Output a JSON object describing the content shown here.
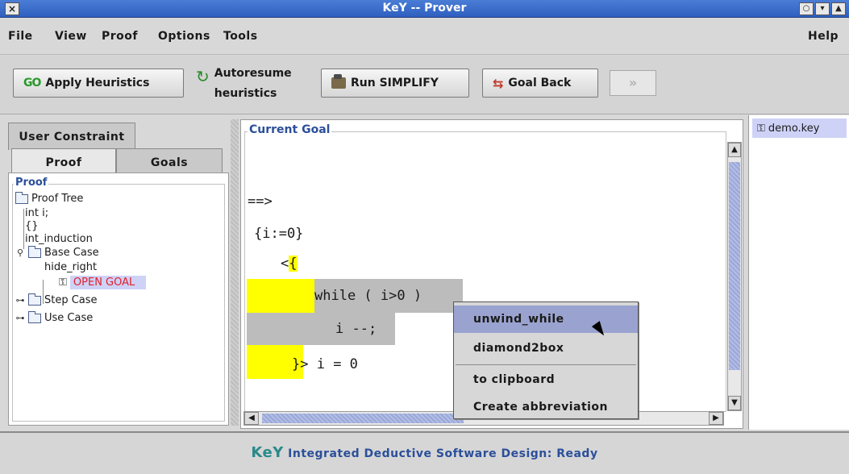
{
  "window": {
    "title": "KeY -- Prover",
    "close_glyph": "×"
  },
  "menu": {
    "file": "File",
    "view": "View",
    "proof": "Proof",
    "options": "Options",
    "tools": "Tools",
    "help": "Help"
  },
  "toolbar": {
    "apply_heuristics": {
      "icon": "GO",
      "label": "Apply Heuristics"
    },
    "autoresume": {
      "line1": "Autoresume",
      "line2": "heuristics"
    },
    "run_simplify": "Run SIMPLIFY",
    "goal_back": "Goal Back",
    "next": "»"
  },
  "left": {
    "tabs": {
      "user_constraint": "User Constraint",
      "proof": "Proof",
      "goals": "Goals"
    },
    "panel_title": "Proof",
    "tree": {
      "root": "Proof Tree",
      "n1": "int i;",
      "n2": "{}",
      "n3": "int_induction",
      "base_case": "Base Case",
      "hide_right": "hide_right",
      "open_goal": "OPEN GOAL",
      "step_case": "Step Case",
      "use_case": "Use Case"
    }
  },
  "goal": {
    "title": "Current Goal",
    "lines": {
      "l1": "==>",
      "l2": "{i:=0}",
      "l3a": "<",
      "l3b": "{",
      "l4": "while ( i>0 )",
      "l5": "i --;",
      "l6a": "}",
      "l6b": "> i = 0"
    }
  },
  "context_menu": {
    "unwind_while": "unwind_while",
    "diamond2box": "diamond2box",
    "to_clipboard": "to clipboard",
    "create_abbreviation": "Create abbreviation"
  },
  "right": {
    "file": "demo.key"
  },
  "status": {
    "logo": "KeY",
    "text": "Integrated Deductive Software Design: Ready"
  },
  "colors": {
    "highlight": "#ffff00",
    "selection": "#cfd2f7",
    "accent": "#2b4f9a",
    "open_goal": "#e0202a"
  }
}
